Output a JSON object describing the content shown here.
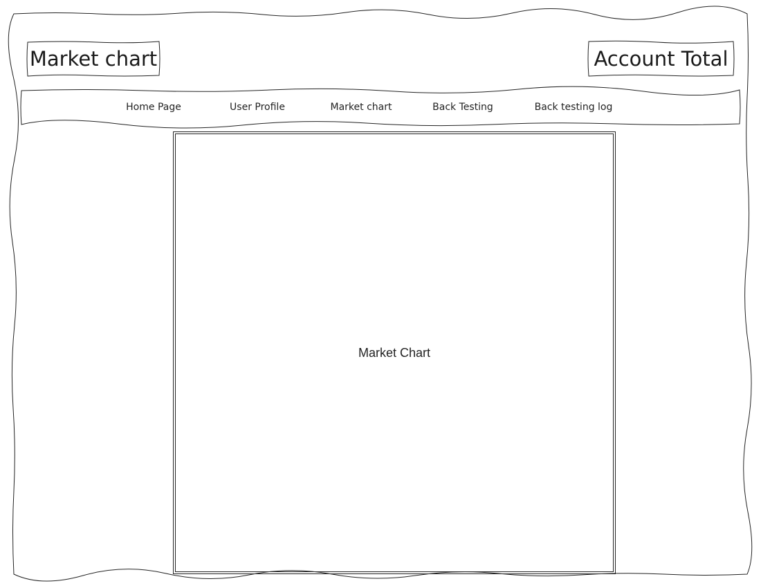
{
  "header": {
    "page_title": "Market chart",
    "account_total": "Account Total"
  },
  "nav": {
    "items": [
      {
        "label": "Home Page"
      },
      {
        "label": "User Profile"
      },
      {
        "label": "Market chart"
      },
      {
        "label": "Back Testing"
      },
      {
        "label": "Back testing log"
      }
    ]
  },
  "main": {
    "chart_placeholder": "Market Chart"
  },
  "colors": {
    "stroke": "#222222",
    "background": "#ffffff"
  }
}
